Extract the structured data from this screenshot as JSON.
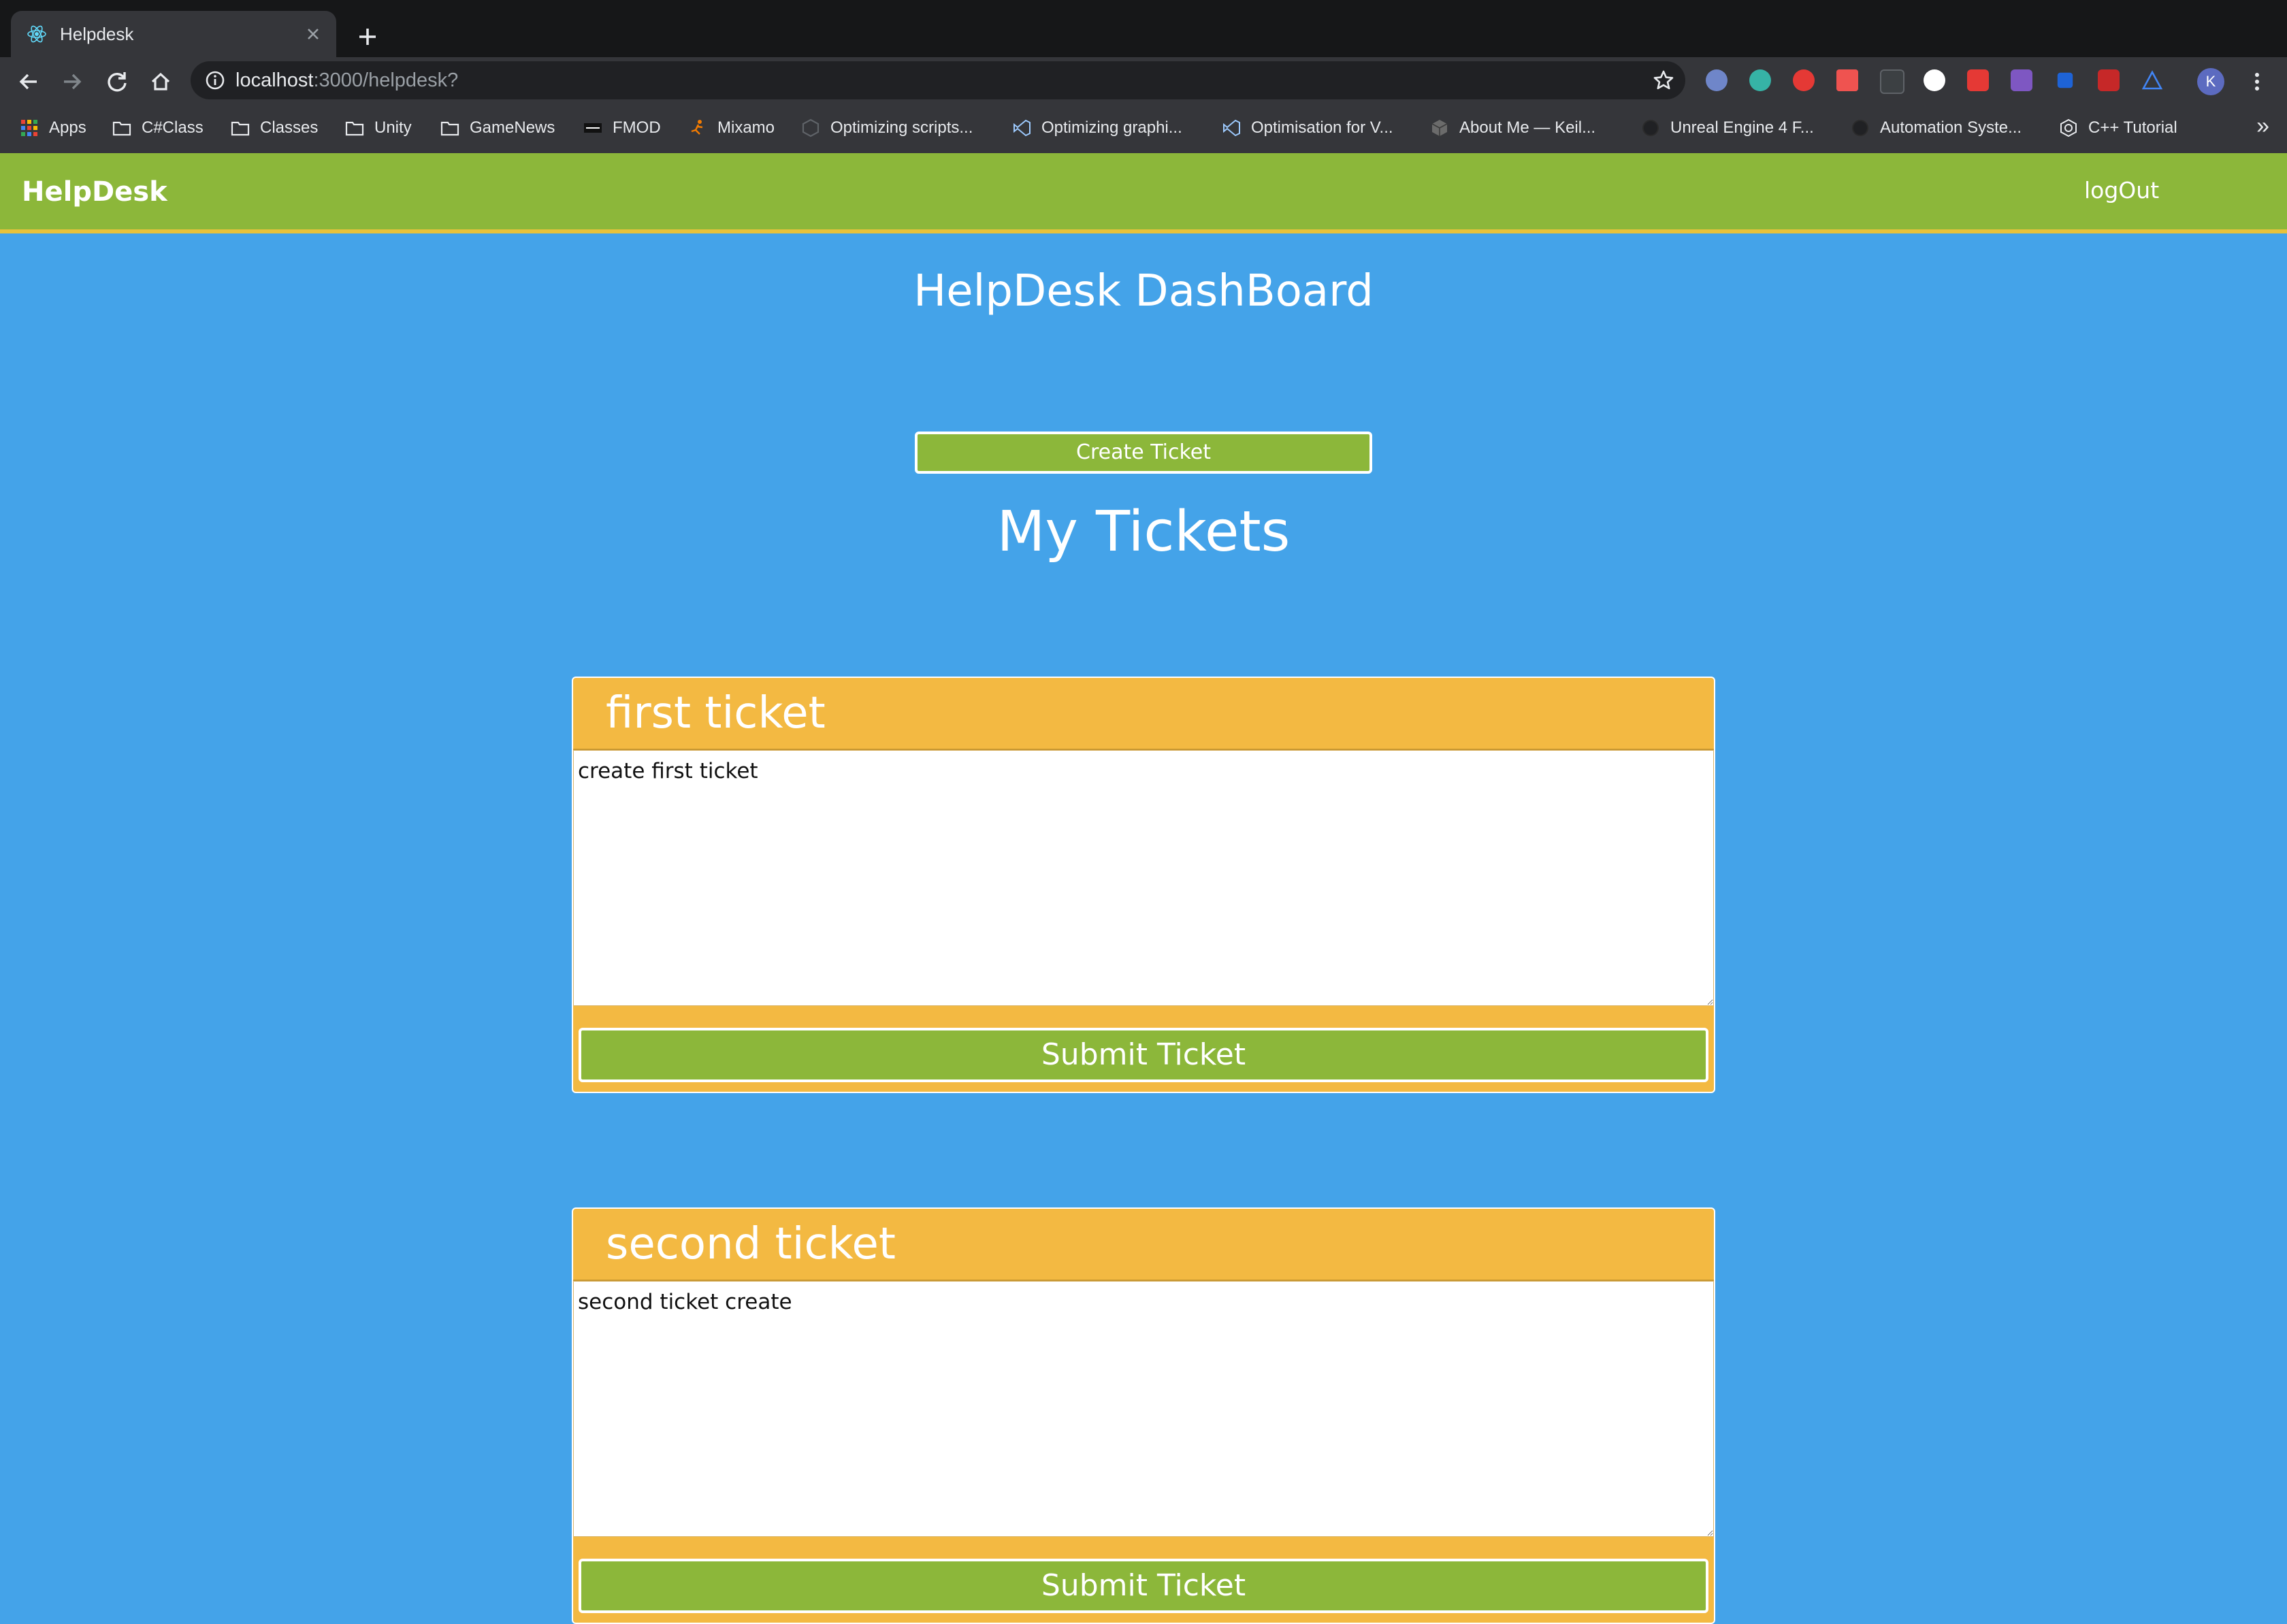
{
  "browser": {
    "tab_title": "Helpdesk",
    "url_host": "localhost",
    "url_path": ":3000/helpdesk?",
    "profile_initial": "K",
    "bookmarks": [
      {
        "label": "Apps",
        "icon": "apps-grid-icon"
      },
      {
        "label": "C#Class",
        "icon": "folder-icon"
      },
      {
        "label": "Classes",
        "icon": "folder-icon"
      },
      {
        "label": "Unity",
        "icon": "folder-icon"
      },
      {
        "label": "GameNews",
        "icon": "folder-icon"
      },
      {
        "label": "FMOD",
        "icon": "fmod-icon"
      },
      {
        "label": "Mixamo",
        "icon": "mixamo-icon"
      },
      {
        "label": "Optimizing scripts...",
        "icon": "unity-icon"
      },
      {
        "label": "Optimizing graphi...",
        "icon": "visual-studio-icon"
      },
      {
        "label": "Optimisation for V...",
        "icon": "visual-studio-icon"
      },
      {
        "label": "About Me — Keil...",
        "icon": "cube-icon"
      },
      {
        "label": "Unreal Engine 4 F...",
        "icon": "unreal-icon"
      },
      {
        "label": "Automation Syste...",
        "icon": "unreal-icon"
      },
      {
        "label": "C++ Tutorial",
        "icon": "cpp-icon"
      }
    ],
    "more_bookmarks": "»"
  },
  "app": {
    "brand": "HelpDesk",
    "logout_label": "logOut",
    "colors": {
      "background": "#44a3e9",
      "navbar": "#8cb73a",
      "ticket": "#f3b942",
      "accent_border": "#e7c23b"
    }
  },
  "dashboard": {
    "title": "HelpDesk DashBoard",
    "create_button": "Create Ticket",
    "section_title": "My Tickets"
  },
  "tickets": [
    {
      "title": "first ticket",
      "body": "create first ticket",
      "submit_label": "Submit Ticket"
    },
    {
      "title": "second ticket",
      "body": "second ticket create",
      "submit_label": "Submit Ticket"
    }
  ]
}
